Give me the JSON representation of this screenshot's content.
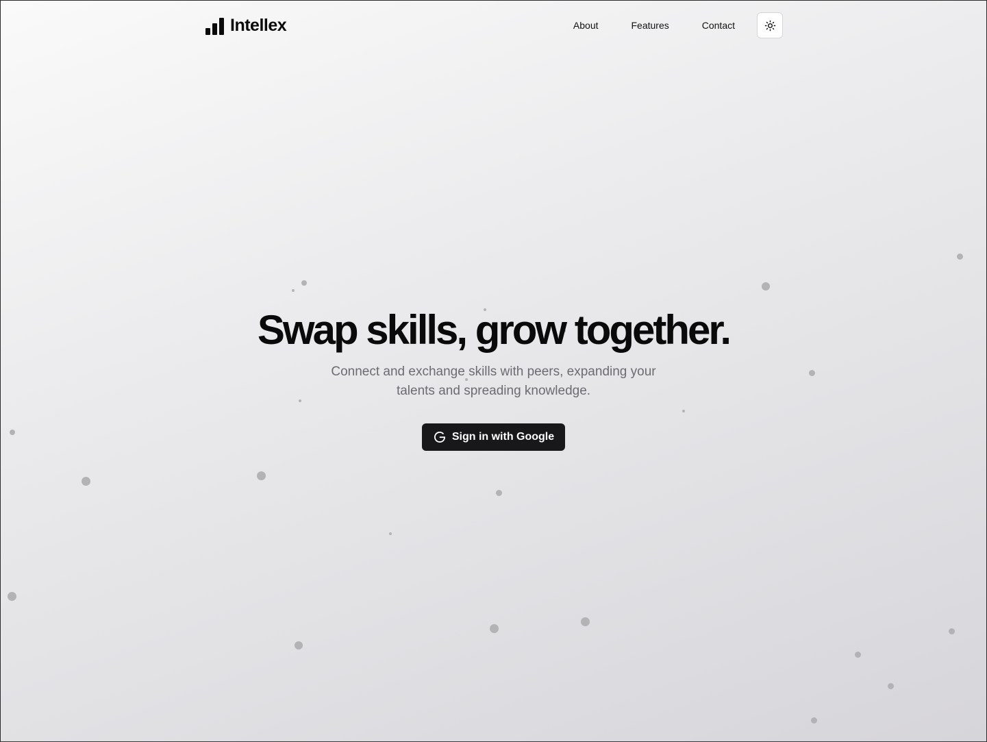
{
  "header": {
    "brand": "Intellex",
    "nav": [
      {
        "label": "About"
      },
      {
        "label": "Features"
      },
      {
        "label": "Contact"
      }
    ],
    "theme_toggle_icon": "sun-icon"
  },
  "hero": {
    "title": "Swap skills, grow together.",
    "subtitle": "Connect and exchange skills with peers, expanding your talents and spreading knowledge.",
    "cta_label": "Sign in with Google",
    "cta_icon": "google-g-icon"
  },
  "colors": {
    "text": "#0a0a0a",
    "muted": "#6b6b72",
    "button_bg": "#18181b",
    "dots": "#b3b3b5"
  }
}
